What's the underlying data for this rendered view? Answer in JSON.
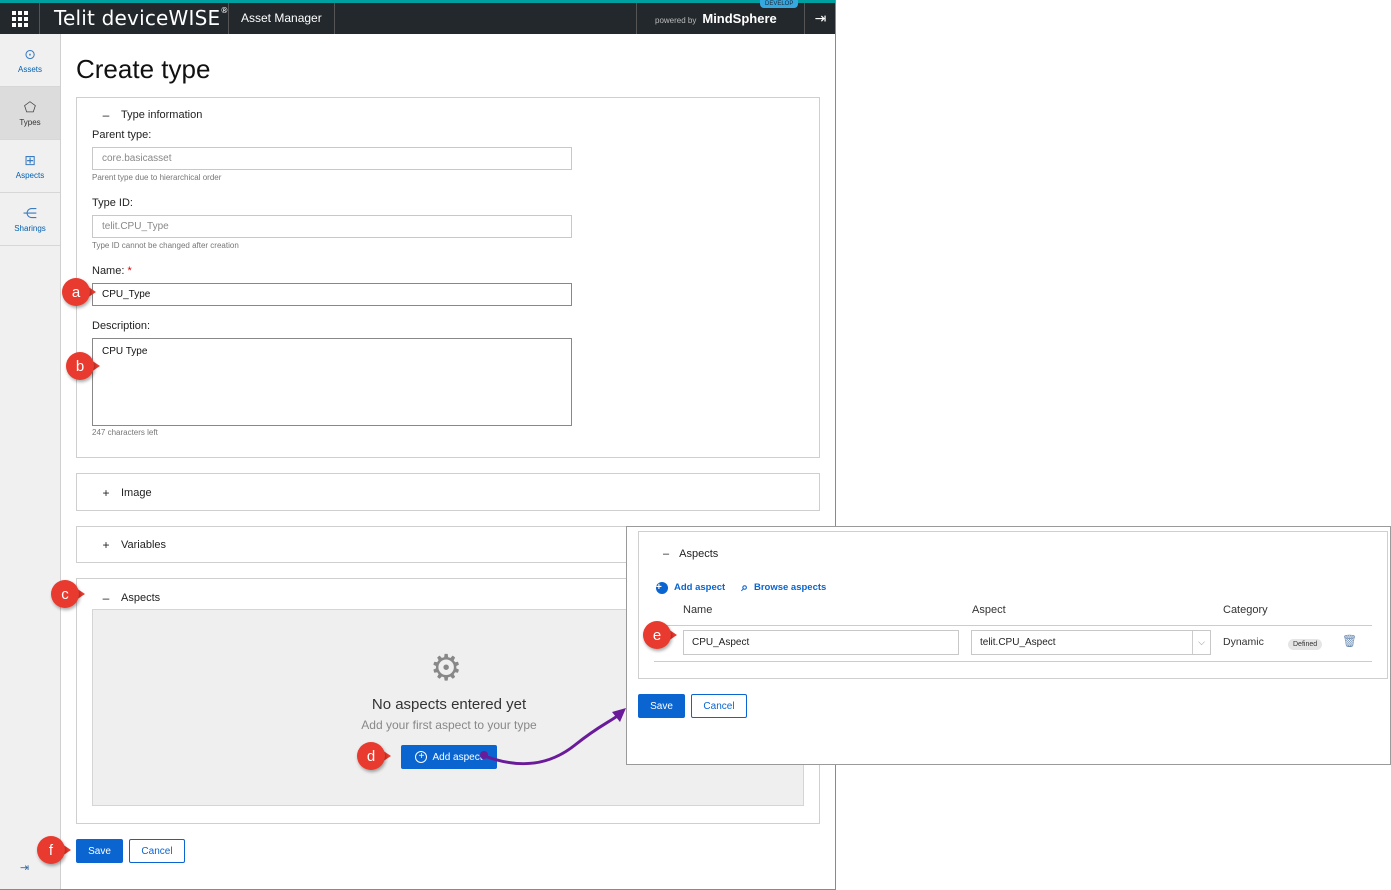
{
  "topbar": {
    "brand": "Telit deviceWISE",
    "brand_mark": "®",
    "app_name": "Asset Manager",
    "powered_by": "powered by",
    "platform": "MindSphere",
    "env_badge": "DEVELOP"
  },
  "sidebar": {
    "items": [
      {
        "label": "Assets",
        "icon": "assets-icon"
      },
      {
        "label": "Types",
        "icon": "types-icon"
      },
      {
        "label": "Aspects",
        "icon": "aspects-icon"
      },
      {
        "label": "Sharings",
        "icon": "sharings-icon"
      }
    ]
  },
  "page": {
    "title": "Create type"
  },
  "type_info": {
    "header": "Type information",
    "parent_type_label": "Parent type:",
    "parent_type_value": "core.basicasset",
    "parent_type_hint": "Parent type due to hierarchical order",
    "type_id_label": "Type ID:",
    "type_id_value": "telit.CPU_Type",
    "type_id_hint": "Type ID cannot be changed after creation",
    "name_label": "Name:",
    "name_required": "*",
    "name_value": "CPU_Type",
    "description_label": "Description:",
    "description_value": "CPU Type",
    "description_hint": "247 characters left"
  },
  "sections": {
    "image": "Image",
    "variables": "Variables",
    "aspects": "Aspects"
  },
  "aspects_empty": {
    "title": "No aspects entered yet",
    "subtitle": "Add your first aspect to your type",
    "add_button": "Add aspect"
  },
  "footer": {
    "save": "Save",
    "cancel": "Cancel"
  },
  "overlay": {
    "header": "Aspects",
    "add_aspect": "Add aspect",
    "browse_aspects": "Browse aspects",
    "columns": [
      "Name",
      "Aspect",
      "Category"
    ],
    "row": {
      "name": "CPU_Aspect",
      "aspect": "telit.CPU_Aspect",
      "category": "Dynamic",
      "badge": "Defined"
    },
    "save": "Save",
    "cancel": "Cancel"
  },
  "callouts": [
    "a",
    "b",
    "c",
    "d",
    "e",
    "f"
  ],
  "colors": {
    "primary": "#0a65d0",
    "topbar": "#23282d",
    "callout": "#e83a2e",
    "arrow": "#6a1b9a"
  }
}
